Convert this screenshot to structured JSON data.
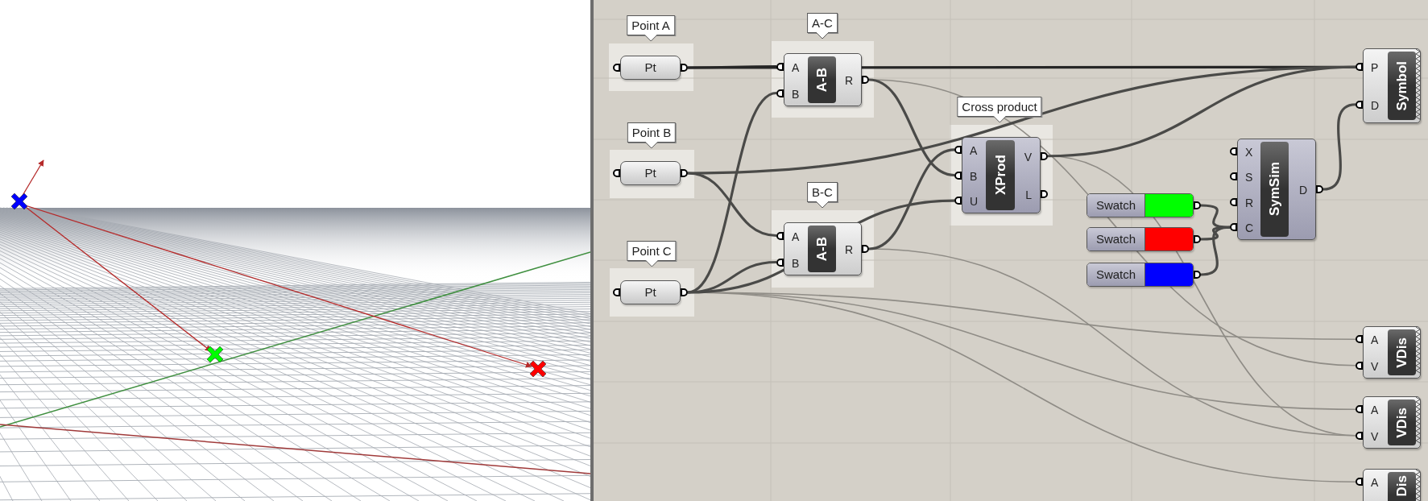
{
  "viewport": {
    "markers": [
      {
        "color": "#0000ff"
      },
      {
        "color": "#00ff00"
      },
      {
        "color": "#ff0000"
      }
    ]
  },
  "canvas": {
    "params": [
      {
        "label": "Point A",
        "name": "Pt"
      },
      {
        "label": "Point B",
        "name": "Pt"
      },
      {
        "label": "Point C",
        "name": "Pt"
      }
    ],
    "components": [
      {
        "label": "A-C",
        "name": "A-B",
        "inputs": [
          "A",
          "B"
        ],
        "outputs": [
          "R"
        ],
        "preview": false
      },
      {
        "label": "B-C",
        "name": "A-B",
        "inputs": [
          "A",
          "B"
        ],
        "outputs": [
          "R"
        ],
        "preview": false
      },
      {
        "label": "Cross product",
        "name": "XProd",
        "inputs": [
          "A",
          "B",
          "U"
        ],
        "outputs": [
          "V",
          "L"
        ],
        "preview": true
      },
      {
        "name": "SymSim",
        "inputs": [
          "X",
          "S",
          "R",
          "C"
        ],
        "outputs": [
          "D"
        ],
        "preview": true
      },
      {
        "name": "Symbol",
        "inputs": [
          "P",
          "D"
        ],
        "preview": false
      },
      {
        "name": "VDis",
        "inputs": [
          "A",
          "V"
        ],
        "preview": false
      },
      {
        "name": "VDis",
        "inputs": [
          "A",
          "V"
        ],
        "preview": false
      },
      {
        "name": "Dis",
        "inputs": [
          "A"
        ],
        "preview": false
      }
    ],
    "swatches": [
      {
        "label": "Swatch",
        "color": "#00ff00"
      },
      {
        "label": "Swatch",
        "color": "#ff0000"
      },
      {
        "label": "Swatch",
        "color": "#0000ff"
      }
    ]
  }
}
